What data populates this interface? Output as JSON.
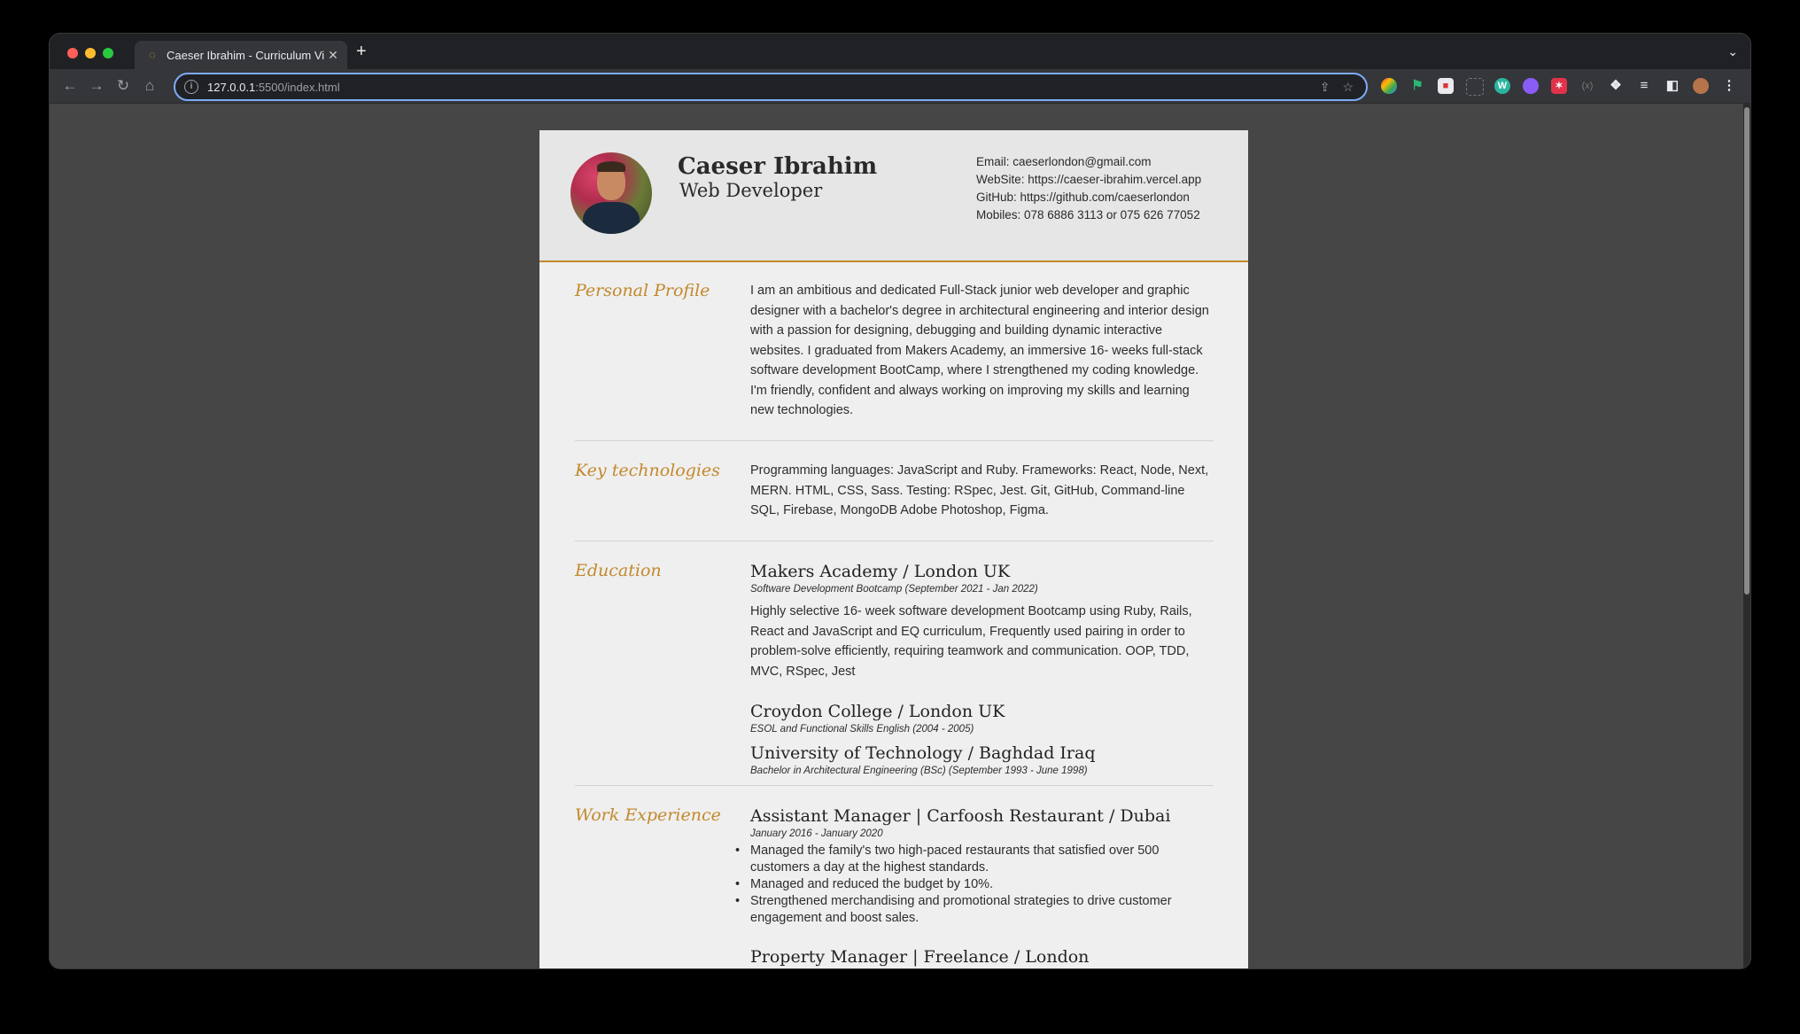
{
  "browser": {
    "tab_title": "Caeser Ibrahim - Curriculum Vi",
    "url_host": "127.0.0.1",
    "url_path": ":5500/index.html"
  },
  "cv": {
    "name": "Caeser Ibrahim",
    "role": "Web Developer",
    "contacts": {
      "email": "Email: caeserlondon@gmail.com",
      "website": "WebSite: https://caeser-ibrahim.vercel.app",
      "github": "GitHub: https://github.com/caeserlondon",
      "mobiles": "Mobiles: 078 6886 3113 or 075 626 77052"
    },
    "profile": {
      "title": "Personal Profile",
      "text": "I am an ambitious and dedicated Full-Stack junior web developer and graphic designer with a bachelor's degree in architectural engineering and interior design with a passion for designing, debugging and building dynamic interactive websites. I graduated from Makers Academy, an immersive 16- weeks full-stack software development BootCamp, where I strengthened my coding knowledge. I'm friendly, confident and always working on improving my skills and learning new technologies."
    },
    "tech": {
      "title": "Key technologies",
      "text": "Programming languages: JavaScript and Ruby. Frameworks: React, Node, Next, MERN. HTML, CSS, Sass. Testing: RSpec, Jest. Git, GitHub, Command-line SQL, Firebase, MongoDB Adobe Photoshop, Figma."
    },
    "education": {
      "title": "Education",
      "items": [
        {
          "title": "Makers Academy / London UK",
          "sub": "Software Development Bootcamp (September 2021 - Jan 2022)",
          "text": "Highly selective 16- week software development Bootcamp using Ruby, Rails, React and JavaScript and EQ curriculum, Frequently used pairing in order to problem-solve efficiently, requiring teamwork and communication. OOP, TDD, MVC, RSpec, Jest"
        },
        {
          "title": "Croydon College / London UK",
          "sub": "ESOL and Functional Skills English (2004 - 2005)"
        },
        {
          "title": "University of Technology / Baghdad Iraq",
          "sub": "Bachelor in Architectural Engineering (BSc) (September 1993 - June 1998)"
        }
      ]
    },
    "work": {
      "title": "Work Experience",
      "items": [
        {
          "title": "Assistant Manager | Carfoosh Restaurant / Dubai",
          "sub": "January 2016 - January 2020",
          "bullets": [
            "Managed the family's two high-paced restaurants that satisfied over 500 customers a day at the highest standards.",
            "Managed and reduced the budget by 10%.",
            "Strengthened merchandising and promotional strategies to drive customer engagement and boost sales."
          ]
        },
        {
          "title": "Property Manager | Freelance / London"
        }
      ]
    }
  }
}
